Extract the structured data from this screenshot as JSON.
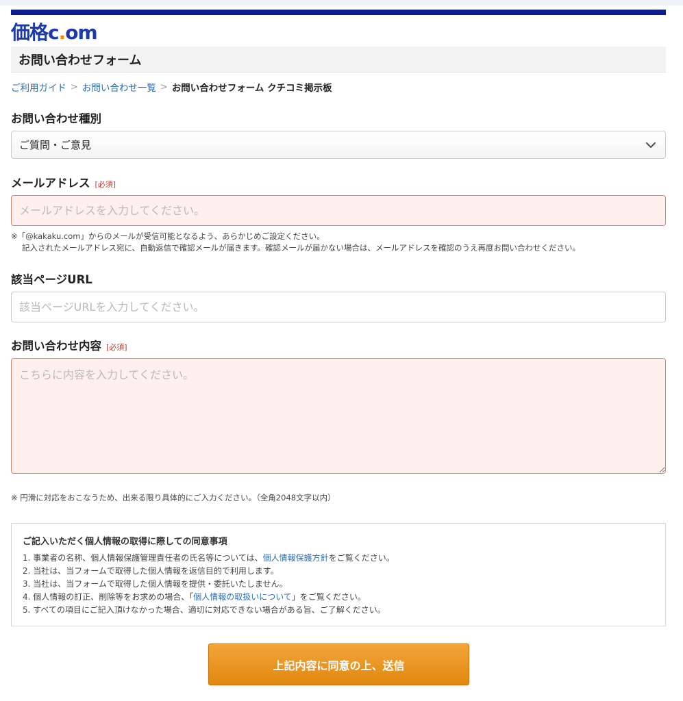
{
  "brand": {
    "logo_kanji": "価格",
    "logo_c": "c",
    "logo_dot": ".",
    "logo_om": "om",
    "bar_color": "#0b1f8a",
    "accent_color": "#f08a00"
  },
  "page": {
    "title": "お問い合わせフォーム"
  },
  "breadcrumb": {
    "items": [
      "ご利用ガイド",
      "お問い合わせ一覧"
    ],
    "current": "お問い合わせフォーム クチコミ掲示板",
    "separator": ">"
  },
  "form": {
    "required_mark": "[必須]",
    "type": {
      "label": "お問い合わせ種別",
      "selected": "ご質問・ご意見"
    },
    "email": {
      "label": "メールアドレス",
      "placeholder": "メールアドレスを入力してください。",
      "note_line1": "※「@kakaku.com」からのメールが受信可能となるよう、あらかじめご設定ください。",
      "note_line2": "記入されたメールアドレス宛に、自動返信で確認メールが届きます。確認メールが届かない場合は、メールアドレスを確認のうえ再度お問い合わせください。"
    },
    "url": {
      "label": "該当ページURL",
      "placeholder": "該当ページURLを入力してください。"
    },
    "content": {
      "label": "お問い合わせ内容",
      "placeholder": "こちらに内容を入力してください。",
      "note": "※ 円滑に対応をおこなうため、出来る限り具体的にご入力ください。（全角2048文字以内）"
    }
  },
  "consent": {
    "title": "ご記入いただく個人情報の取得に際しての同意事項",
    "item1_pre": "1. 事業者の名称、個人情報保護管理責任者の氏名等については、",
    "item1_link": "個人情報保護方針",
    "item1_post": "をご覧ください。",
    "item2": "2. 当社は、当フォームで取得した個人情報を返信目的で利用します。",
    "item3": "3. 当社は、当フォームで取得した個人情報を提供・委託いたしません。",
    "item4_pre": "4. 個人情報の訂正、削除等をお求めの場合、「",
    "item4_link": "個人情報の取扱いについて",
    "item4_post": "」をご覧ください。",
    "item5": "5. すべての項目にご記入頂けなかった場合、適切に対応できない場合がある旨、ご了解ください。"
  },
  "submit": {
    "label": "上記内容に同意の上、送信",
    "color": "#e9961f"
  }
}
